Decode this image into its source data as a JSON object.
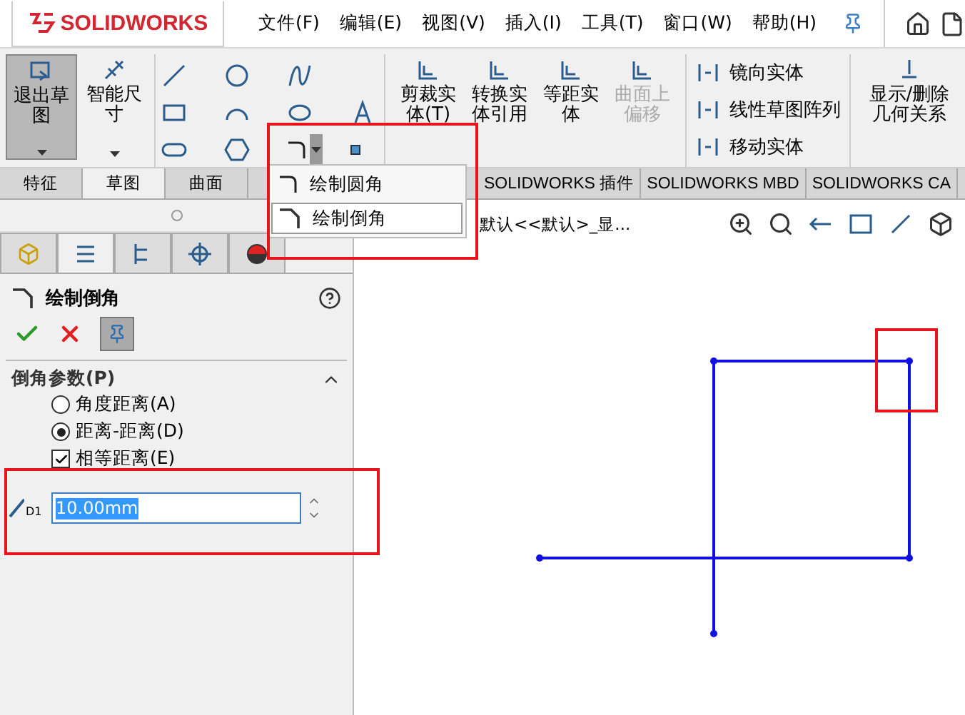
{
  "app": {
    "logo": "SOLIDWORKS"
  },
  "menu": [
    "文件(F)",
    "编辑(E)",
    "视图(V)",
    "插入(I)",
    "工具(T)",
    "窗口(W)",
    "帮助(H)"
  ],
  "ribbon": {
    "large_buttons": [
      {
        "label": "退出草图",
        "pressed": true
      },
      {
        "label": "智能尺寸",
        "pressed": false
      }
    ],
    "edit_buttons": [
      {
        "label": "剪裁实体(T)",
        "disabled": false
      },
      {
        "label": "转换实体引用",
        "disabled": false
      },
      {
        "label": "等距实体",
        "disabled": false
      },
      {
        "label": "曲面上偏移",
        "disabled": true
      }
    ],
    "list_tools": [
      "镜向实体",
      "线性草图阵列",
      "移动实体"
    ],
    "relations_button": "显示/删除几何关系"
  },
  "tabs": [
    {
      "label": "特征",
      "selected": false
    },
    {
      "label": "草图",
      "selected": true
    },
    {
      "label": "曲面",
      "selected": false
    },
    {
      "label": "SOLIDWORKS 插件",
      "selected": false
    },
    {
      "label": "SOLIDWORKS MBD",
      "selected": false
    },
    {
      "label": "SOLIDWORKS CA",
      "selected": false
    }
  ],
  "fillet_menu": {
    "items": [
      {
        "label": "绘制圆角",
        "selected": false
      },
      {
        "label": "绘制倒角",
        "selected": true
      }
    ]
  },
  "property_manager": {
    "title": "绘制倒角",
    "section": {
      "title": "倒角参数(P)",
      "expanded": true
    },
    "options": [
      {
        "label": "角度距离(A)",
        "selected": false
      },
      {
        "label": "距离-距离(D)",
        "selected": true
      }
    ],
    "equal_distance": {
      "label": "相等距离(E)",
      "checked": true
    },
    "distance": {
      "label": "D1",
      "value": "10.00mm"
    }
  },
  "viewport": {
    "breadcrumb": "默认<<默认>_显..."
  }
}
